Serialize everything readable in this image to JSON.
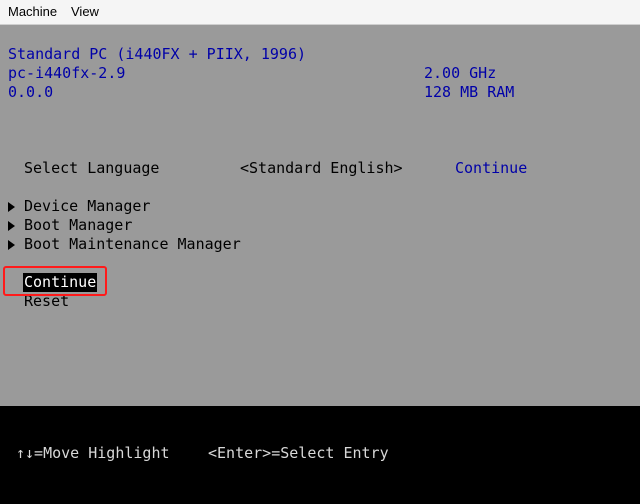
{
  "menubar": {
    "machine_label": "Machine",
    "view_label": "View"
  },
  "system_info": {
    "platform": "Standard PC (i440FX + PIIX, 1996)",
    "machine_version": "pc-i440fx-2.9",
    "version": "0.0.0",
    "cpu_speed": "2.00 GHz",
    "memory": "128 MB RAM"
  },
  "language": {
    "label": "Select Language",
    "value": "<Standard English>",
    "help_text": "Continue"
  },
  "menu": {
    "items": [
      {
        "label": "Device Manager"
      },
      {
        "label": "Boot Manager"
      },
      {
        "label": "Boot Maintenance Manager"
      }
    ],
    "continue_label": "Continue",
    "reset_label": "Reset"
  },
  "footer": {
    "move_hint": "↑↓=Move Highlight",
    "enter_hint": "<Enter>=Select Entry"
  },
  "colors": {
    "screen_background": "#9a9a9a",
    "info_text": "#0000a8",
    "highlight_box": "#ff1a1a",
    "footer_background": "#000000"
  }
}
